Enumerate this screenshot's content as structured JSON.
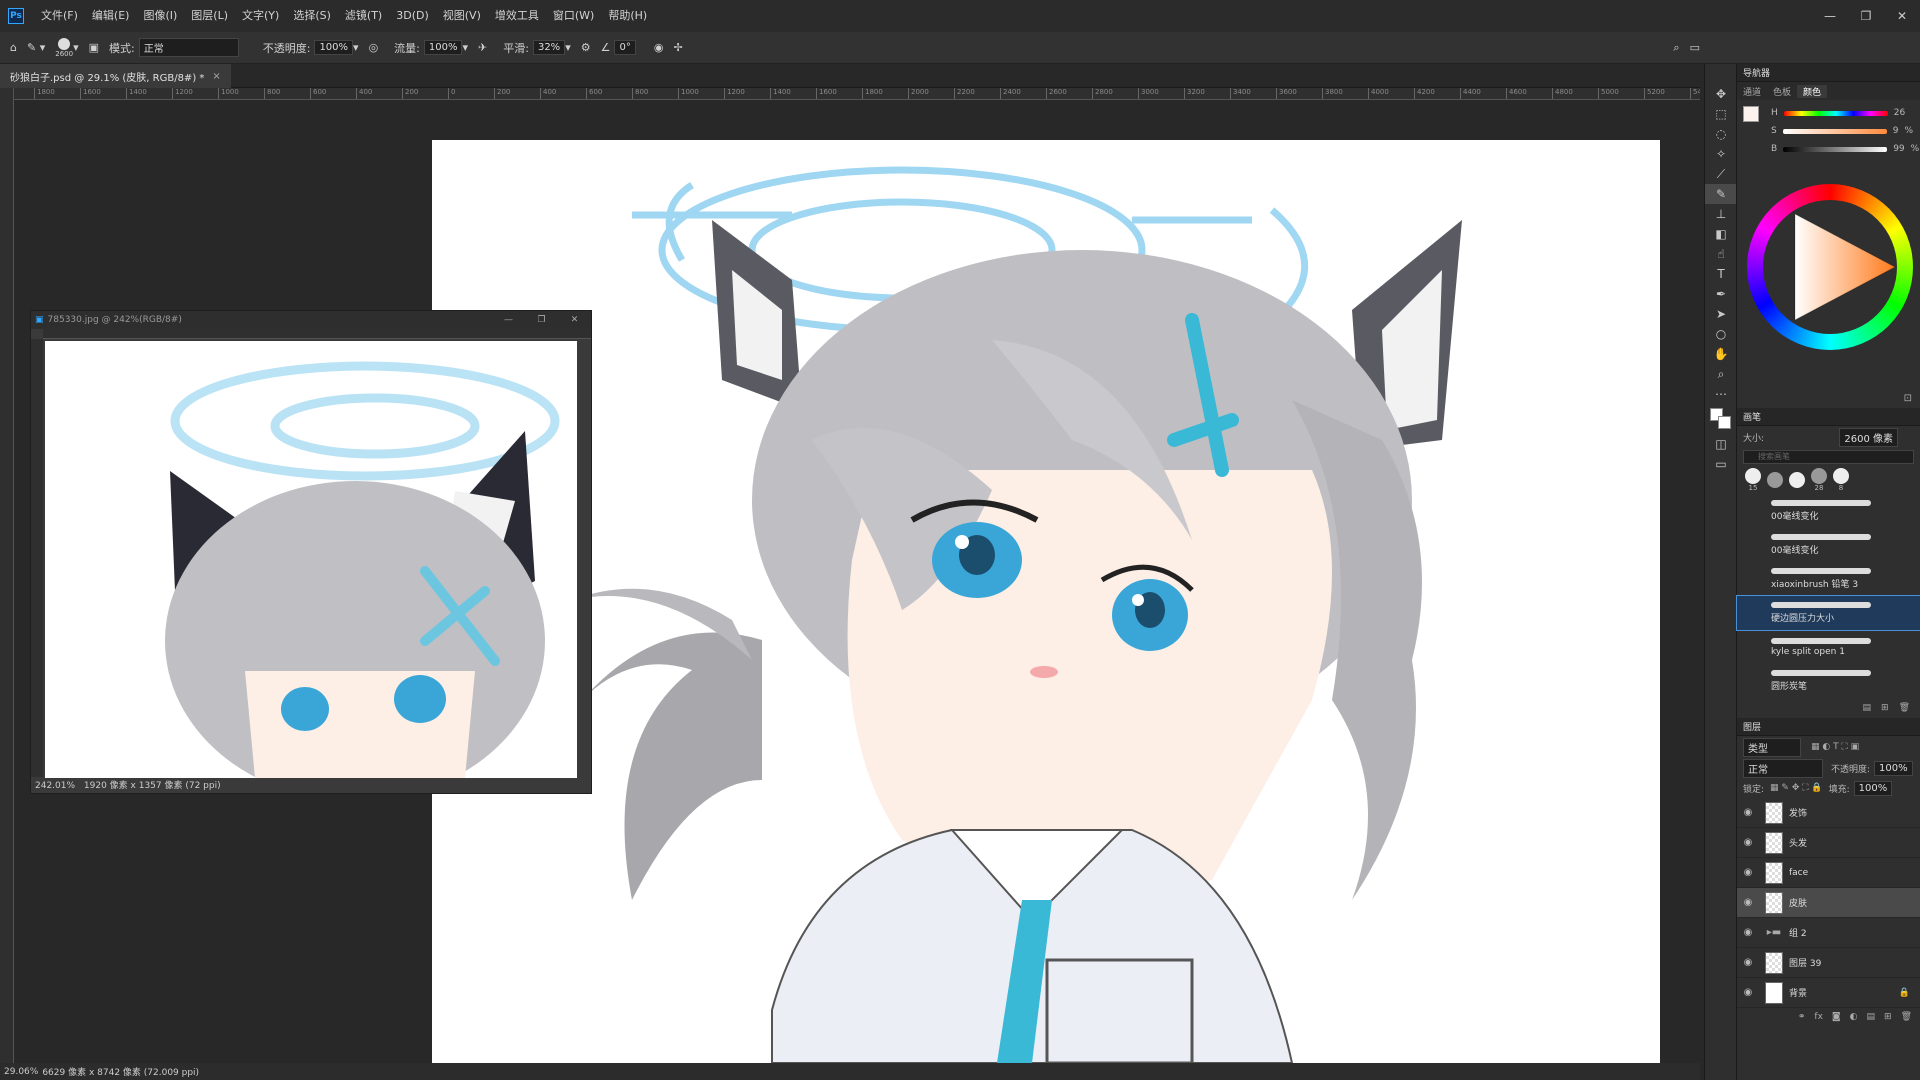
{
  "app": {
    "logo": "Ps",
    "menu": [
      "文件(F)",
      "编辑(E)",
      "图像(I)",
      "图层(L)",
      "文字(Y)",
      "选择(S)",
      "滤镜(T)",
      "3D(D)",
      "视图(V)",
      "增效工具",
      "窗口(W)",
      "帮助(H)"
    ]
  },
  "window_controls": {
    "minimize": "—",
    "restore": "❐",
    "close": "✕"
  },
  "options": {
    "brush_size": "2600",
    "mode_label": "模式:",
    "mode_value": "正常",
    "opacity_label": "不透明度:",
    "opacity_value": "100%",
    "flow_label": "流量:",
    "flow_value": "100%",
    "smooth_label": "平滑:",
    "smooth_value": "32%",
    "angle_value": "0°"
  },
  "document": {
    "tab": "砂狼白子.psd @ 29.1% (皮肤, RGB/8#) *",
    "close": "×",
    "status": "29.06%",
    "dims": "6629 像素 x 8742 像素 (72.009 ppi)"
  },
  "ruler_labels": [
    "1800",
    "1600",
    "1400",
    "1200",
    "1000",
    "800",
    "600",
    "400",
    "200",
    "0",
    "200",
    "400",
    "600",
    "800",
    "1000",
    "1200",
    "1400",
    "1600",
    "1800",
    "2000",
    "2200",
    "2400",
    "2600",
    "2800",
    "3000",
    "3200",
    "3400",
    "3600",
    "3800",
    "4000",
    "4200",
    "4400",
    "4600",
    "4800",
    "5000",
    "5200",
    "5400"
  ],
  "float_window": {
    "title": "785330.jpg @ 242%(RGB/8#)",
    "zoom": "242.01%",
    "dims": "1920 像素 x 1357 像素 (72 ppi)"
  },
  "navigator": {
    "title": "导航器"
  },
  "color_panel": {
    "tabs": [
      "通道",
      "色板",
      "颜色"
    ],
    "active_tab": "颜色",
    "h_label": "H",
    "h_value": "26",
    "s_label": "S",
    "s_value": "9",
    "s_unit": "%",
    "b_label": "B",
    "b_value": "99",
    "b_unit": "%"
  },
  "brush_panel": {
    "title": "画笔",
    "size_label": "大小:",
    "size_value": "2600 像素",
    "search_placeholder": "搜索画笔",
    "preset_sizes": [
      "15",
      "",
      "",
      "28",
      "8"
    ],
    "brushes": [
      {
        "name": "00毫线变化"
      },
      {
        "name": "00毫线变化"
      },
      {
        "name": "xiaoxinbrush 铅笔 3"
      },
      {
        "name": "硬边圆压力大小",
        "selected": true
      },
      {
        "name": "kyle split open 1"
      },
      {
        "name": "圆形炭笔"
      }
    ]
  },
  "layers_panel": {
    "title": "图层",
    "filter_label": "类型",
    "blend_mode": "正常",
    "opacity_label": "不透明度:",
    "opacity_value": "100%",
    "lock_label": "锁定:",
    "fill_label": "填充:",
    "fill_value": "100%",
    "layers": [
      {
        "name": "发饰",
        "type": "pixel"
      },
      {
        "name": "头发",
        "type": "pixel"
      },
      {
        "name": "face",
        "type": "pixel"
      },
      {
        "name": "皮肤",
        "type": "pixel",
        "selected": true
      },
      {
        "name": "组 2",
        "type": "group"
      },
      {
        "name": "图层 39",
        "type": "pixel"
      },
      {
        "name": "背景",
        "type": "white",
        "locked": true
      }
    ]
  },
  "colors": {
    "accent": "#31a8ff",
    "halo": "#8fd0f0",
    "hair": "#b8b8bc",
    "eye": "#3aa6d8",
    "tie": "#3ab9d6"
  }
}
